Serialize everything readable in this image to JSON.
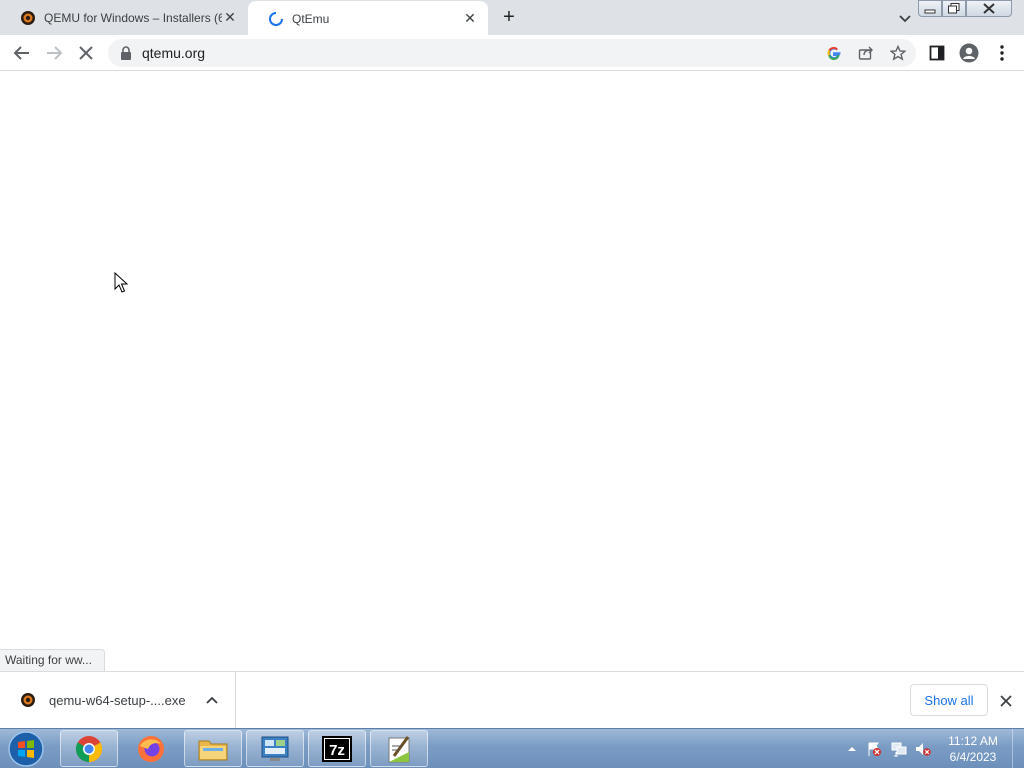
{
  "tabs": [
    {
      "title": "QEMU for Windows – Installers (6",
      "icon": "qemu-icon",
      "active": false
    },
    {
      "title": "QtEmu",
      "icon": "loading-spinner-icon",
      "active": true
    }
  ],
  "toolbar": {
    "url": "qtemu.org"
  },
  "status": {
    "text": "Waiting for ww..."
  },
  "download_shelf": {
    "file_name": "qemu-w64-setup-....exe",
    "show_all_label": "Show all"
  },
  "taskbar": {
    "apps": [
      "chrome-icon",
      "firefox-icon",
      "file-explorer-icon",
      "control-panel-icon",
      "7zip-icon",
      "notepad-plus-plus-icon"
    ],
    "time": "11:12 AM",
    "date": "6/4/2023"
  },
  "colors": {
    "tabstrip": "#dee1e6",
    "accent": "#1a73e8",
    "taskbar": "#7a9cc4"
  }
}
